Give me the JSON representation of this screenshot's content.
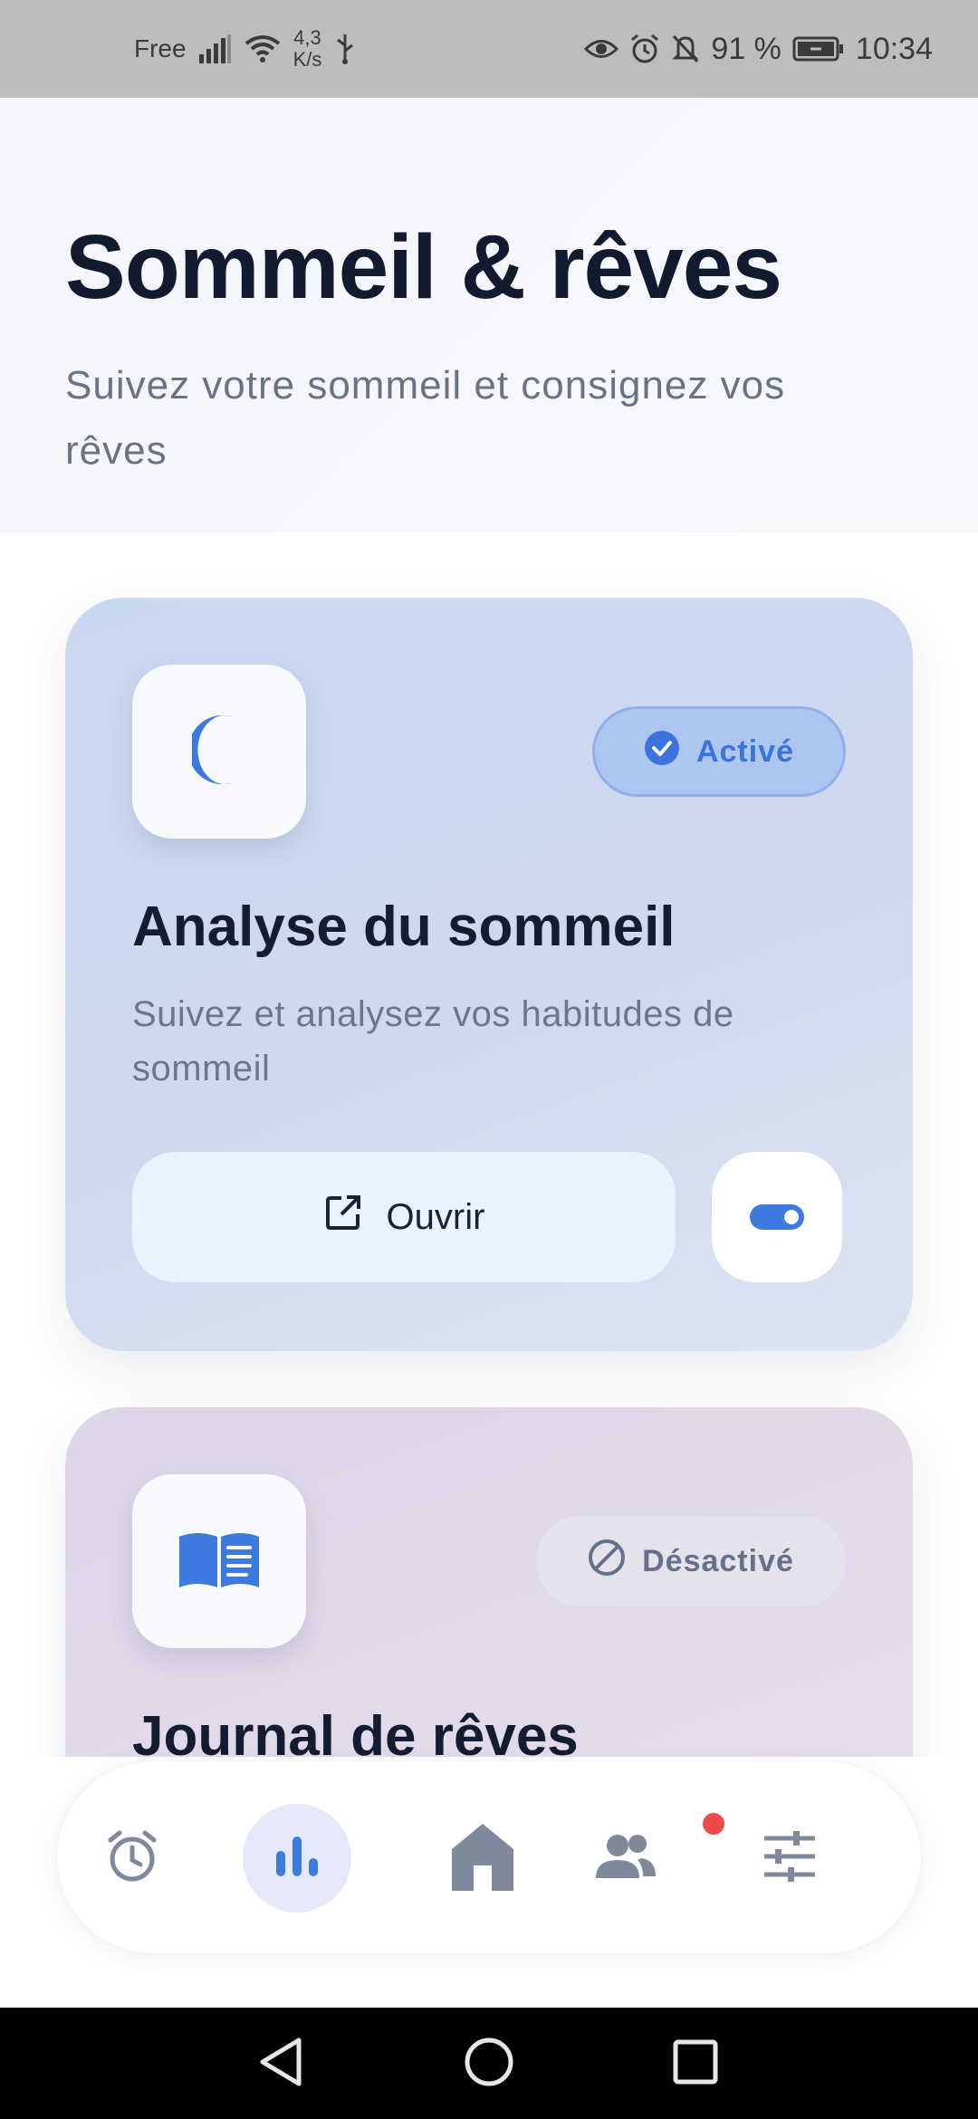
{
  "status_bar": {
    "carrier": "Free",
    "speed_value": "4,3",
    "speed_unit": "K/s",
    "battery": "91 %",
    "time": "10:34"
  },
  "header": {
    "title": "Sommeil & rêves",
    "subtitle": "Suivez votre sommeil et consignez vos rêves"
  },
  "cards": [
    {
      "icon": "moon-icon",
      "status": "Activé",
      "title": "Analyse du sommeil",
      "description": "Suivez et analysez vos habitudes de sommeil",
      "open_label": "Ouvrir",
      "enabled": true
    },
    {
      "icon": "book-icon",
      "status": "Désactivé",
      "title": "Journal de rêves",
      "enabled": false
    }
  ],
  "bottom_nav": {
    "items": [
      "alarm-icon",
      "chart-icon",
      "home-icon",
      "people-icon",
      "settings-sliders-icon"
    ],
    "active": "chart-icon"
  },
  "colors": {
    "accent": "#3d7ae0",
    "title": "#111a2e",
    "notification": "#ef4a4a"
  }
}
